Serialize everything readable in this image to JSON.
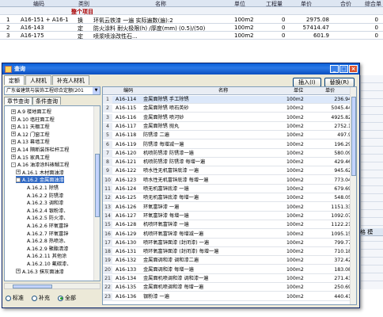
{
  "background": {
    "headers": [
      "编码",
      "类别",
      "名称",
      "单位",
      "工程量",
      "单价",
      "合价",
      "综合单"
    ],
    "section_label": "整个项目",
    "rows": [
      {
        "idx": "1",
        "code": "A16-151 + A16-1",
        "type": "换",
        "name": "环氧云铁漆 一遍 实际遍数(遍):2",
        "unit": "100m2",
        "qty": "0",
        "price": "2975.08",
        "total": "0"
      },
      {
        "idx": "2",
        "code": "A16-143",
        "type": "定",
        "name": "防火涂料 耐火极限(h) /厚度(mm) (0.5)/(50)",
        "unit": "100m2",
        "qty": "0",
        "price": "57414.47",
        "total": "0"
      },
      {
        "idx": "3",
        "code": "A16-175",
        "type": "定",
        "name": "喷浆喷涂改性石...",
        "unit": "100m2",
        "qty": "0",
        "price": "601.9",
        "total": "0"
      }
    ],
    "right_header": "格  模"
  },
  "dialog": {
    "title": "查询",
    "tabs": [
      "定额",
      "人材机",
      "补充人材机"
    ],
    "insert_button": "插入(I)",
    "replace_button": "替换(R)",
    "library": "广东省建筑与装饰工程综合定额(201",
    "subtabs": [
      "章节查询",
      "条件查询"
    ],
    "tree": [
      {
        "label": "A.9 楼地面工程",
        "indent": 1,
        "exp": "+"
      },
      {
        "label": "A.10 墙柱面工程",
        "indent": 1,
        "exp": "+"
      },
      {
        "label": "A.11 天棚工程",
        "indent": 1,
        "exp": "+"
      },
      {
        "label": "A.12 门窗工程",
        "indent": 1,
        "exp": "+"
      },
      {
        "label": "A.13 幕墙工程",
        "indent": 1,
        "exp": "+"
      },
      {
        "label": "A.14 隔断装饰栏杆工程",
        "indent": 1,
        "exp": "+"
      },
      {
        "label": "A.15 家具工程",
        "indent": 1,
        "exp": "+"
      },
      {
        "label": "A.16 油漆涂料裱糊工程",
        "indent": 1,
        "exp": "-"
      },
      {
        "label": "A.16.1 木材面油漆",
        "indent": 2,
        "exp": "+"
      },
      {
        "label": "A.16.2 金属面油漆",
        "indent": 2,
        "exp": "-",
        "selected": true
      },
      {
        "label": "A.16.2.1 除锈",
        "indent": 3,
        "exp": ""
      },
      {
        "label": "A.16.2.2 防锈漆",
        "indent": 3,
        "exp": ""
      },
      {
        "label": "A.16.2.3 调和漆",
        "indent": 3,
        "exp": ""
      },
      {
        "label": "A.16.2.4 银粉漆、",
        "indent": 3,
        "exp": ""
      },
      {
        "label": "A.16.2.5 防火漆、",
        "indent": 3,
        "exp": ""
      },
      {
        "label": "A.16.2.6 环氧富锌",
        "indent": 3,
        "exp": ""
      },
      {
        "label": "A.16.2.7 环氧富锌",
        "indent": 3,
        "exp": ""
      },
      {
        "label": "A.16.2.8 热喷涂、",
        "indent": 3,
        "exp": ""
      },
      {
        "label": "A.16.2.9 聚酯清漆",
        "indent": 3,
        "exp": ""
      },
      {
        "label": "A.16.2.11 其他涂",
        "indent": 3,
        "exp": ""
      },
      {
        "label": "A.16.2.10 氟碳漆、",
        "indent": 3,
        "exp": ""
      },
      {
        "label": "A.16.3 抹灰面油漆",
        "indent": 2,
        "exp": "+"
      }
    ],
    "radios": [
      {
        "label": "标准",
        "on": false
      },
      {
        "label": "补充",
        "on": false
      },
      {
        "label": "全部",
        "on": true
      }
    ],
    "grid_headers": [
      "编码",
      "名称",
      "单位",
      "单价"
    ],
    "grid_rows": [
      {
        "n": "1",
        "code": "A16-114",
        "name": "金属面除锈 手工除锈",
        "unit": "100m2",
        "price": "236.94"
      },
      {
        "n": "2",
        "code": "A16-115",
        "name": "金属面除锈 喷石英砂",
        "unit": "100m2",
        "price": "5045.44"
      },
      {
        "n": "3",
        "code": "A16-116",
        "name": "金属面除锈 喷河砂",
        "unit": "100m2",
        "price": "4925.82"
      },
      {
        "n": "4",
        "code": "A16-117",
        "name": "金属面除锈 抛丸",
        "unit": "100m2",
        "price": "2752.1"
      },
      {
        "n": "5",
        "code": "A16-118",
        "name": "防锈漆 二遍",
        "unit": "100m2",
        "price": "497.9"
      },
      {
        "n": "6",
        "code": "A16-119",
        "name": "防锈漆 每增减一遍",
        "unit": "100m2",
        "price": "196.29"
      },
      {
        "n": "7",
        "code": "A16-120",
        "name": "机喷防锈漆 防锈漆一遍",
        "unit": "100m2",
        "price": "580.09"
      },
      {
        "n": "8",
        "code": "A16-121",
        "name": "机喷防锈漆 防锈漆 每增一遍",
        "unit": "100m2",
        "price": "429.46"
      },
      {
        "n": "9",
        "code": "A16-122",
        "name": "喷水性无机富锌底漆 一遍",
        "unit": "100m2",
        "price": "945.62"
      },
      {
        "n": "10",
        "code": "A16-123",
        "name": "喷水性无机富锌底漆 每增一遍",
        "unit": "100m2",
        "price": "773.04"
      },
      {
        "n": "11",
        "code": "A16-124",
        "name": "喷无机富锌底漆 一遍",
        "unit": "100m2",
        "price": "679.69"
      },
      {
        "n": "12",
        "code": "A16-125",
        "name": "喷无机富锌底漆 每增一遍",
        "unit": "100m2",
        "price": "548.05"
      },
      {
        "n": "13",
        "code": "A16-126",
        "name": "环氧富锌漆 一遍",
        "unit": "100m2",
        "price": "1151.33"
      },
      {
        "n": "14",
        "code": "A16-127",
        "name": "环氧富锌漆 每增一遍",
        "unit": "100m2",
        "price": "1092.07"
      },
      {
        "n": "15",
        "code": "A16-128",
        "name": "机喷环氧富锌漆 一遍",
        "unit": "100m2",
        "price": "1122.21"
      },
      {
        "n": "16",
        "code": "A16-129",
        "name": "机喷环氧富锌漆 每增减一遍",
        "unit": "100m2",
        "price": "1095.15"
      },
      {
        "n": "17",
        "code": "A16-130",
        "name": "喷环氧富锌面漆 (封闭漆) 一遍",
        "unit": "100m2",
        "price": "799.77"
      },
      {
        "n": "18",
        "code": "A16-131",
        "name": "喷环氧富锌面漆 (封闭漆) 每增一遍",
        "unit": "100m2",
        "price": "710.18"
      },
      {
        "n": "19",
        "code": "A16-132",
        "name": "金属面调和漆 调和漆二遍",
        "unit": "100m2",
        "price": "372.42"
      },
      {
        "n": "20",
        "code": "A16-133",
        "name": "金属面调和漆 每增一遍",
        "unit": "100m2",
        "price": "183.08"
      },
      {
        "n": "21",
        "code": "A16-134",
        "name": "金属面机喷调和漆 调和漆一遍",
        "unit": "100m2",
        "price": "271.43"
      },
      {
        "n": "22",
        "code": "A16-135",
        "name": "金属面机喷调和漆 每增一遍",
        "unit": "100m2",
        "price": "250.69"
      },
      {
        "n": "23",
        "code": "A16-136",
        "name": "银粉漆 一遍",
        "unit": "100m2",
        "price": "440.41"
      }
    ]
  }
}
